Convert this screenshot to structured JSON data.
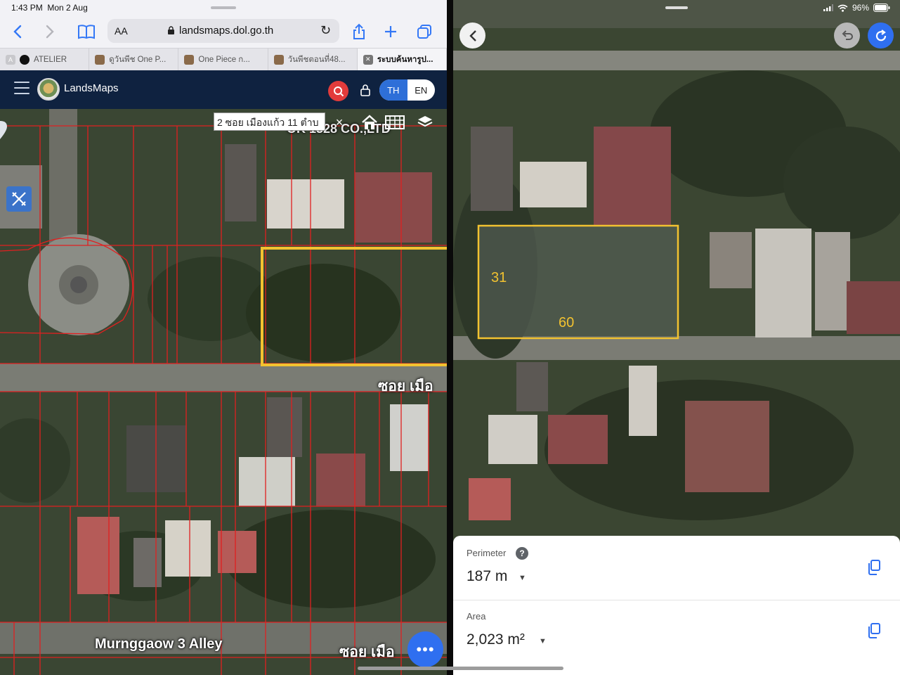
{
  "status_left": {
    "time": "1:43 PM",
    "date": "Mon 2 Aug"
  },
  "safari": {
    "aa_label": "AA",
    "url": "landsmaps.dol.go.th",
    "icons": [
      "back-icon",
      "forward-icon",
      "bookmarks-icon",
      "lock-icon",
      "reload-icon",
      "share-icon",
      "new-tab-icon",
      "tabs-overview-icon"
    ],
    "tabs": [
      {
        "label": "ATELIER",
        "favicon": "A"
      },
      {
        "label": "ดูวันพีช One P..."
      },
      {
        "label": "One Piece ก..."
      },
      {
        "label": "วันพีชตอนที่48..."
      },
      {
        "label": "ระบบค้นหารูป..."
      }
    ]
  },
  "landsmaps": {
    "brand": "LandsMaps",
    "lang_th": "TH",
    "lang_en": "EN",
    "address": "2 ซอย เมืองแก้ว 11 ตำบ",
    "clear": "×",
    "map_label_company": "OK 1328 CO.,LTD",
    "street_soi_upper": "ซอย เมือ",
    "street_alley": "Murnggaow 3 Alley",
    "street_soi_lower": "ซอย เมือ",
    "more_label": "•••"
  },
  "status_right": {
    "battery": "96%"
  },
  "measure": {
    "side_label_a": "31",
    "side_label_b": "60",
    "perimeter_label": "Perimeter",
    "perimeter_value": "187 m",
    "help": "?",
    "area_label": "Area",
    "area_value": "2,023 m²"
  },
  "colors": {
    "parcel_line": "#e02020",
    "highlight": "#f2c230",
    "accent_blue": "#2f6ff0",
    "header_navy": "#0f2240"
  }
}
